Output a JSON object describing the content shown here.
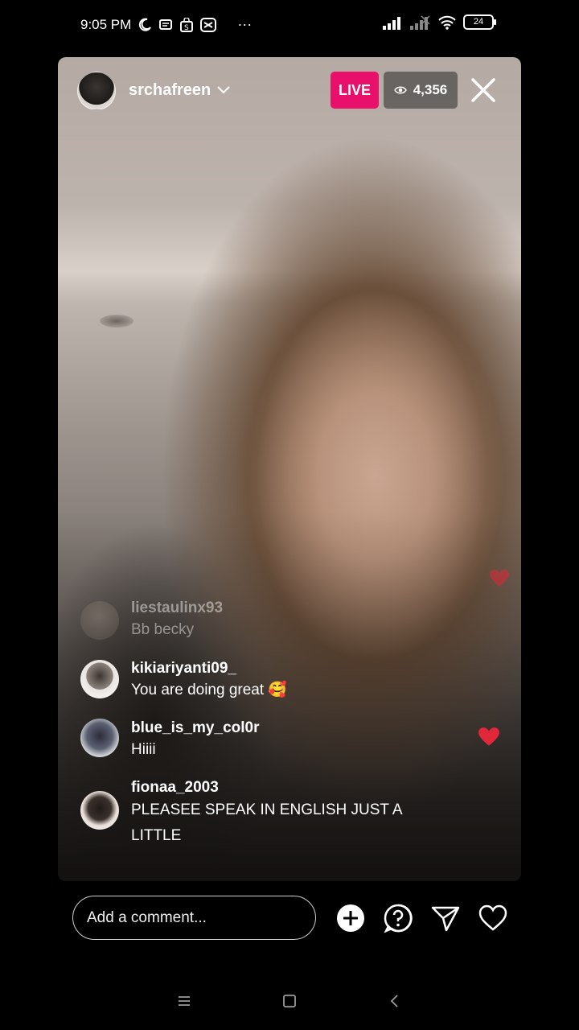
{
  "status_bar": {
    "time": "9:05 PM",
    "battery": "24",
    "more": "···",
    "icons": [
      "moon-icon",
      "sms-icon",
      "shop-icon",
      "capcut-icon",
      "signal-icon",
      "signal-weak-icon",
      "wifi-icon",
      "battery-icon"
    ]
  },
  "live": {
    "host_name": "srchafreen",
    "live_label": "LIVE",
    "viewer_count": "4,356"
  },
  "comments": [
    {
      "user": "liestaulinx93",
      "text": "Bb becky",
      "faded": true
    },
    {
      "user": "kikiariyanti09_",
      "text": "You are doing great 🥰"
    },
    {
      "user": "blue_is_my_col0r",
      "text": "Hiiii"
    },
    {
      "user": "fionaa_2003",
      "text": "PLEASEE SPEAK IN ENGLISH JUST A",
      "text2": "LITTLE"
    }
  ],
  "bottom_bar": {
    "placeholder": "Add a comment..."
  },
  "colors": {
    "live_badge": "#e8106a",
    "heart": "#e0283a"
  }
}
